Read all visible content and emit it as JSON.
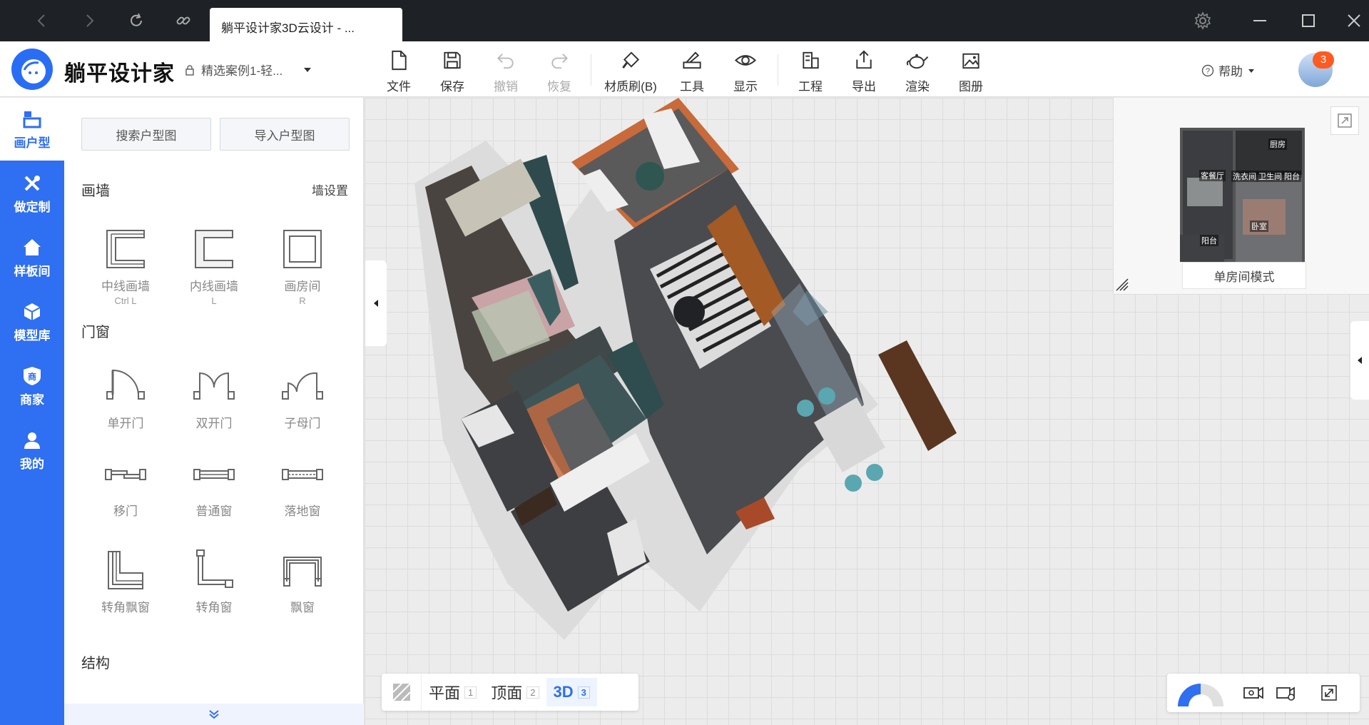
{
  "titlebar": {
    "tab_title": "躺平设计家3D云设计 - ..."
  },
  "header": {
    "brand": "躺平设计家",
    "project_name": "精选案例1-轻...",
    "tools": [
      {
        "label": "文件",
        "icon": "file-icon"
      },
      {
        "label": "保存",
        "icon": "save-icon"
      },
      {
        "label": "撤销",
        "icon": "undo-icon"
      },
      {
        "label": "恢复",
        "icon": "redo-icon"
      },
      {
        "label": "材质刷(B)",
        "icon": "material-brush-icon"
      },
      {
        "label": "工具",
        "icon": "tools-icon"
      },
      {
        "label": "显示",
        "icon": "eye-icon"
      },
      {
        "label": "工程",
        "icon": "project-icon"
      },
      {
        "label": "导出",
        "icon": "export-icon"
      },
      {
        "label": "渲染",
        "icon": "render-teapot-icon"
      },
      {
        "label": "图册",
        "icon": "album-icon"
      }
    ],
    "help_label": "帮助",
    "notification_count": "3"
  },
  "sidebar": {
    "items": [
      {
        "label": "画户型",
        "icon": "floorplan-icon"
      },
      {
        "label": "做定制",
        "icon": "customize-tools-icon"
      },
      {
        "label": "样板间",
        "icon": "house-icon"
      },
      {
        "label": "模型库",
        "icon": "cube-icon"
      },
      {
        "label": "商家",
        "icon": "merchant-icon"
      },
      {
        "label": "我的",
        "icon": "user-icon"
      }
    ]
  },
  "panel": {
    "search_floorplan": "搜索户型图",
    "import_floorplan": "导入户型图",
    "wall_section": "画墙",
    "wall_settings": "墙设置",
    "walls": [
      {
        "label": "中线画墙",
        "key": "Ctrl L"
      },
      {
        "label": "内线画墙",
        "key": "L"
      },
      {
        "label": "画房间",
        "key": "R"
      }
    ],
    "doors_section": "门窗",
    "doors": [
      {
        "label": "单开门"
      },
      {
        "label": "双开门"
      },
      {
        "label": "子母门"
      },
      {
        "label": "移门"
      },
      {
        "label": "普通窗"
      },
      {
        "label": "落地窗"
      },
      {
        "label": "转角飘窗"
      },
      {
        "label": "转角窗"
      },
      {
        "label": "飘窗"
      }
    ],
    "structure_section": "结构"
  },
  "minimap": {
    "rooms": [
      "厨房",
      "客餐厅",
      "洗衣间",
      "卫生间",
      "阳台",
      "卧室",
      "阳台"
    ],
    "mode_button": "单房间模式"
  },
  "viewbar": {
    "views": [
      {
        "label": "平面",
        "shortcut": "1"
      },
      {
        "label": "顶面",
        "shortcut": "2"
      },
      {
        "label": "3D",
        "shortcut": "3"
      }
    ]
  }
}
